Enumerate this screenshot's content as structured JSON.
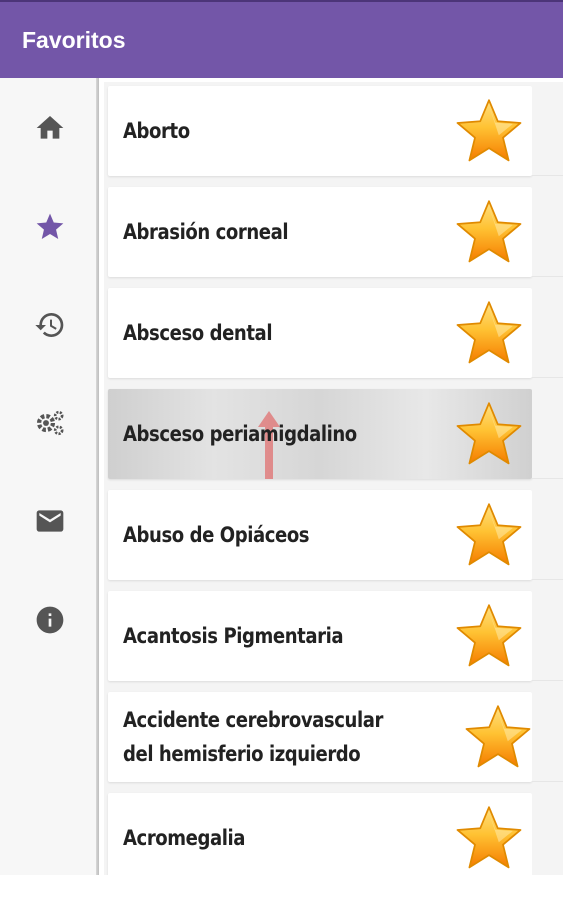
{
  "app": {
    "title": "Favoritos",
    "accent_color": "#7356a8"
  },
  "sidebar": {
    "items": [
      {
        "icon": "home-icon",
        "active": false
      },
      {
        "icon": "star-icon",
        "active": true
      },
      {
        "icon": "history-icon",
        "active": false
      },
      {
        "icon": "settings-icon",
        "active": false
      },
      {
        "icon": "mail-icon",
        "active": false
      },
      {
        "icon": "info-icon",
        "active": false
      }
    ],
    "active_color": "#7356a8",
    "inactive_color": "#555555"
  },
  "favorites": {
    "items": [
      {
        "label": "Aborto",
        "starred": true
      },
      {
        "label": "Abrasión corneal",
        "starred": true
      },
      {
        "label": "Absceso dental",
        "starred": true
      },
      {
        "label": "Absceso periamigdalino",
        "starred": true,
        "selected": true
      },
      {
        "label": "Abuso de Opiáceos",
        "starred": true
      },
      {
        "label": "Acantosis Pigmentaria",
        "starred": true
      },
      {
        "label": "Accidente cerebrovascular del hemisferio izquierdo",
        "starred": true
      },
      {
        "label": "Acromegalia",
        "starred": true
      }
    ],
    "star_color": "#f9a825"
  }
}
